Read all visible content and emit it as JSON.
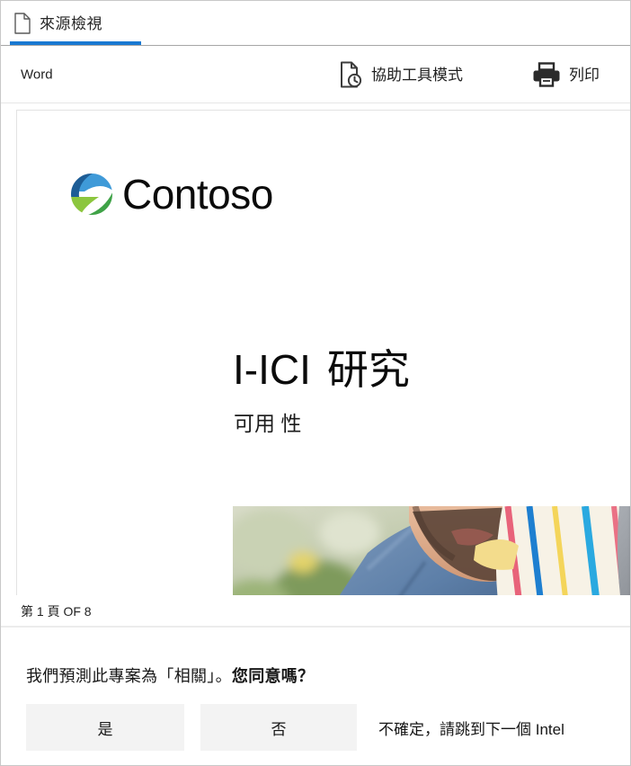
{
  "tab": {
    "label": "來源檢視",
    "icon": "document-icon",
    "active_color": "#1979d2"
  },
  "toolbar": {
    "app_label": "Word",
    "accessibility_label": "協助工具模式",
    "accessibility_icon": "document-accessibility-icon",
    "print_label": "列印",
    "print_icon": "printer-icon"
  },
  "document": {
    "brand_name": "Contoso",
    "brand_logo": "contoso-swoosh-logo",
    "title_left": "I-ICI",
    "title_right": "研究",
    "subtitle": "可用 性",
    "hero_image": "father-and-child-photo"
  },
  "page_status": {
    "text": "第 1 頁  OF 8",
    "current_page": 1,
    "total_pages": 8
  },
  "prompt": {
    "question_lead": "我們預測此專案為「相關」。",
    "question_emphasis": "您同意嗎？",
    "answers": [
      {
        "label": "是",
        "name": "yes"
      },
      {
        "label": "否",
        "name": "no"
      },
      {
        "label": "不確定，請跳到下一個 Intel",
        "name": "unsure"
      }
    ]
  }
}
